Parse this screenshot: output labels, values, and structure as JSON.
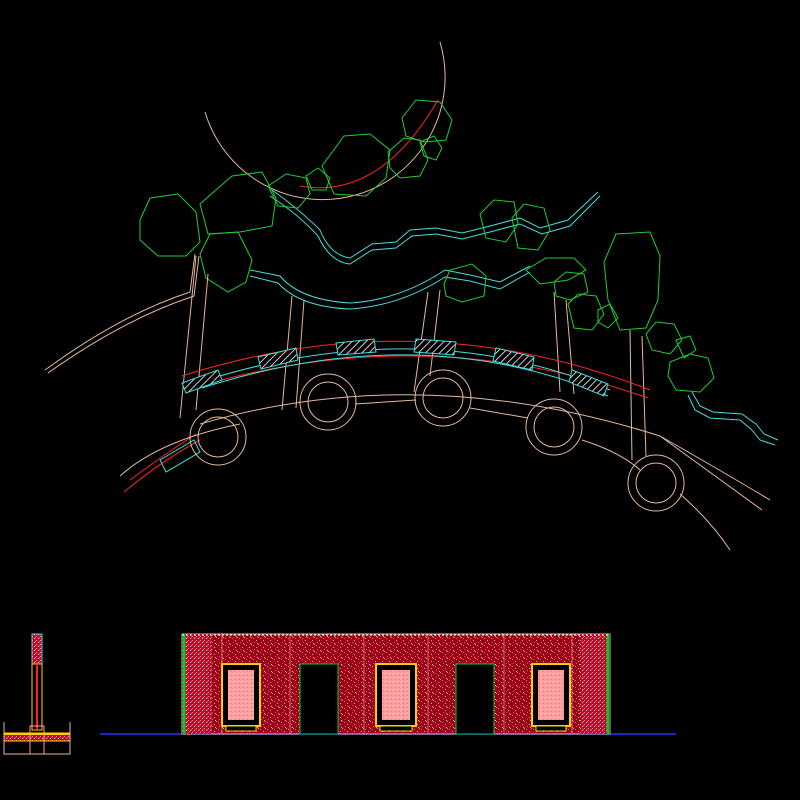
{
  "drawing": {
    "background": "#000000",
    "colors": {
      "hedge": "#22cc33",
      "water": "#44dddd",
      "pavement": "#e6b89c",
      "axis": "#ff2222",
      "wall_fill": "#bb0022",
      "wall_speckle": "#ff5555",
      "frame": "#00cc33",
      "window": "#ffd000",
      "panel": "#ff9999",
      "ground": "#2233ff",
      "yellow_band": "#ffd000"
    },
    "views": [
      "plan",
      "section",
      "elevation"
    ],
    "plan_columns": 5,
    "elevation_windows": 3,
    "elevation_doors": 2
  }
}
